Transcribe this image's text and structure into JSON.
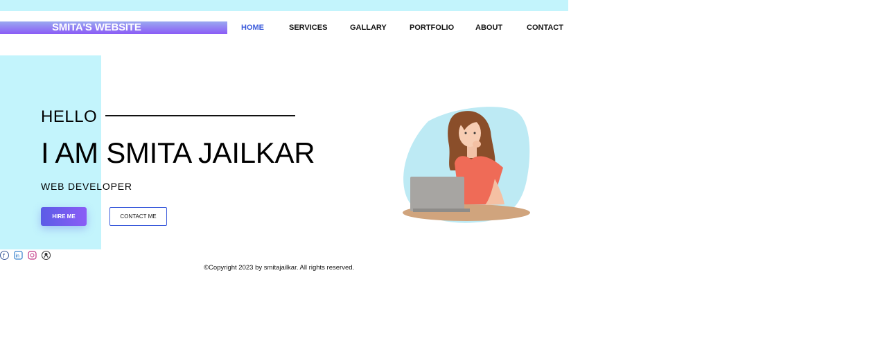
{
  "brand": {
    "title": "SMITA'S WEBSITE"
  },
  "nav": {
    "items": [
      "HOME",
      "SERVICES",
      "GALLARY",
      "PORTFOLIO",
      "ABOUT",
      "CONTACT"
    ],
    "active": "HOME"
  },
  "hero": {
    "greeting": "HELLO",
    "name": "I AM SMITA JAILKAR",
    "role": "WEB DEVELOPER",
    "hire_button": "HIRE ME",
    "contact_button": "CONTACT ME"
  },
  "social": {
    "icons": [
      "facebook-icon",
      "linkedin-icon",
      "instagram-icon",
      "github-icon"
    ]
  },
  "footer": {
    "copyright": "©Copyright 2023 by smitajailkar. All rights reserved."
  },
  "colors": {
    "accent": "#3b5bdb",
    "panel": "#c3f4fc",
    "brand_gradient_top": "#9aa8f0",
    "brand_gradient_bottom": "#8b5cf6",
    "button_gradient_start": "#5b5ce6",
    "button_gradient_end": "#8b5cf6"
  }
}
